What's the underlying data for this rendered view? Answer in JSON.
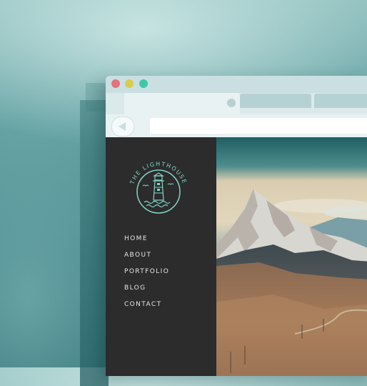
{
  "window": {
    "traffic_lights": {
      "close": "#e2737a",
      "minimize": "#d9cc4f",
      "maximize": "#3ec8a8"
    }
  },
  "browser": {
    "back_icon": "back-arrow-icon"
  },
  "sidebar": {
    "logo": {
      "text": "THE LIGHTHOUSE",
      "icon": "lighthouse-icon"
    },
    "nav": [
      "HOME",
      "ABOUT",
      "PORTFOLIO",
      "BLOG",
      "CONTACT"
    ]
  },
  "hero": {
    "image": "snowy-mountain-landscape"
  },
  "colors": {
    "accent": "#7fd6c8",
    "sidebar_bg": "#2c2c2c",
    "chrome": "#c9dfe1"
  }
}
